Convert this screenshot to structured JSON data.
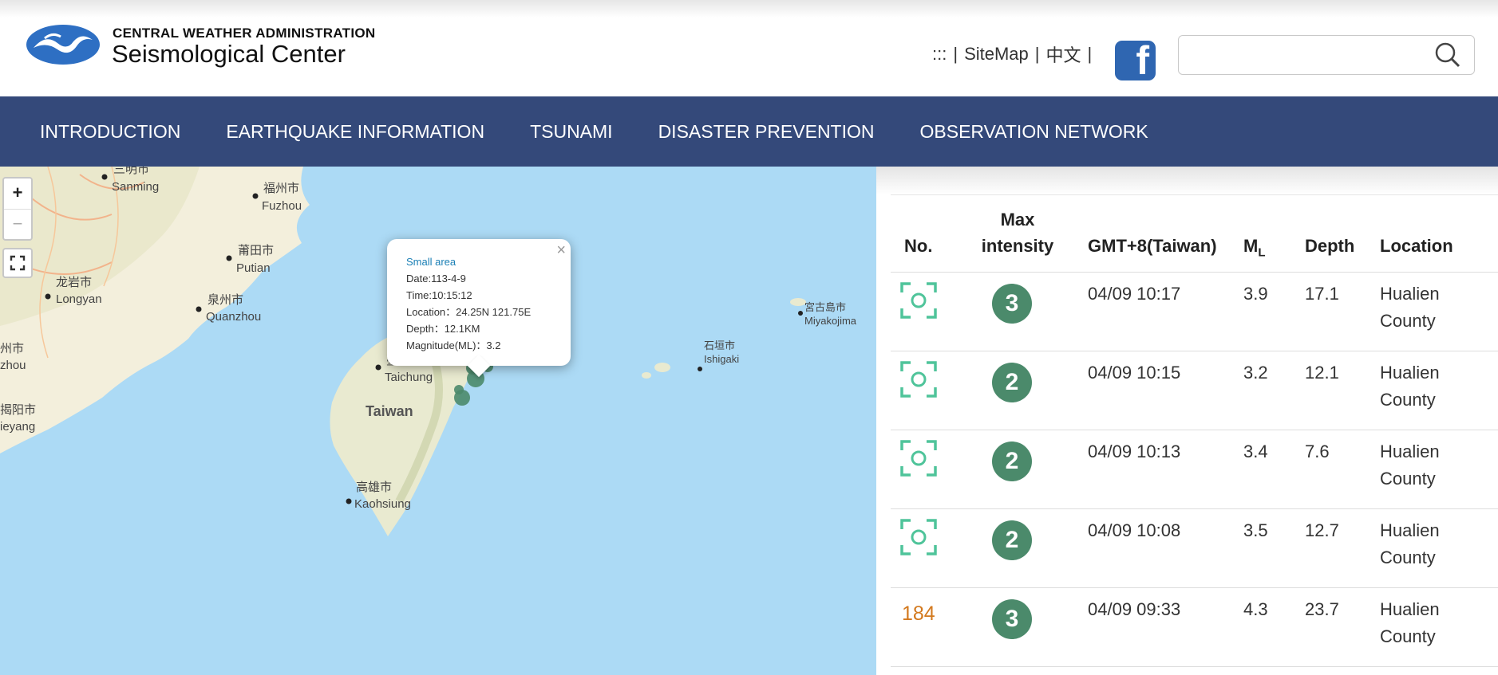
{
  "header": {
    "brand_top": "CENTRAL WEATHER ADMINISTRATION",
    "brand_main": "Seismological Center",
    "links": [
      ":::",
      "|",
      "SiteMap",
      "|",
      "中文",
      "|"
    ],
    "facebook_letter": "f",
    "search_placeholder": ""
  },
  "nav": {
    "items": [
      "INTRODUCTION",
      "EARTHQUAKE INFORMATION",
      "TSUNAMI",
      "DISASTER PREVENTION",
      "OBSERVATION NETWORK"
    ]
  },
  "map": {
    "zoom_in": "+",
    "zoom_out": "−",
    "labels": {
      "sanming_cn": "三明市",
      "sanming": "Sanming",
      "fuzhou_cn": "福州市",
      "fuzhou": "Fuzhou",
      "putian_cn": "莆田市",
      "putian": "Putian",
      "longyan_cn": "龙岩市",
      "longyan": "Longyan",
      "quanzhou_cn": "泉州市",
      "quanzhou": "Quanzhou",
      "zhou_cn": "州市",
      "zhou": "zhou",
      "jieyang_cn": "揭阳市",
      "jieyang": "ieyang",
      "taichung_cn": "臺中市",
      "taichung": "Taichung",
      "taiwan": "Taiwan",
      "kaohsiung_cn": "高雄市",
      "kaohsiung": "Kaohsiung",
      "miyakojima_cn": "宮古島市",
      "miyakojima": "Miyakojima",
      "ishigaki_cn": "石垣市",
      "ishigaki": "Ishigaki"
    },
    "popup": {
      "title": "Small area",
      "date": "Date:113-4-9",
      "time": "Time:10:15:12",
      "location": "Location：24.25N 121.75E",
      "depth": "Depth：12.1KM",
      "magnitude": "Magnitude(ML)：3.2",
      "close": "×"
    }
  },
  "table": {
    "headers": {
      "no": "No.",
      "max_line1": "Max",
      "max_line2": "intensity",
      "time": "GMT+8(Taiwan)",
      "ml": "M",
      "ml_sub": "L",
      "depth": "Depth",
      "location": "Location"
    },
    "rows": [
      {
        "no": "",
        "intensity": "3",
        "time": "04/09 10:17",
        "ml": "3.9",
        "depth": "17.1",
        "loc1": "Hualien",
        "loc2": "County"
      },
      {
        "no": "",
        "intensity": "2",
        "time": "04/09 10:15",
        "ml": "3.2",
        "depth": "12.1",
        "loc1": "Hualien",
        "loc2": "County"
      },
      {
        "no": "",
        "intensity": "2",
        "time": "04/09 10:13",
        "ml": "3.4",
        "depth": "7.6",
        "loc1": "Hualien",
        "loc2": "County"
      },
      {
        "no": "",
        "intensity": "2",
        "time": "04/09 10:08",
        "ml": "3.5",
        "depth": "12.7",
        "loc1": "Hualien",
        "loc2": "County"
      },
      {
        "no": "184",
        "intensity": "3",
        "time": "04/09 09:33",
        "ml": "4.3",
        "depth": "23.7",
        "loc1": "Hualien",
        "loc2": "County"
      }
    ]
  },
  "colors": {
    "nav_bg": "#34497a",
    "badge": "#4b8a6b",
    "scan_icon": "#4fc49a",
    "row_number": "#d3791e",
    "sea": "#acdaf5",
    "land": "#f4efdc"
  }
}
